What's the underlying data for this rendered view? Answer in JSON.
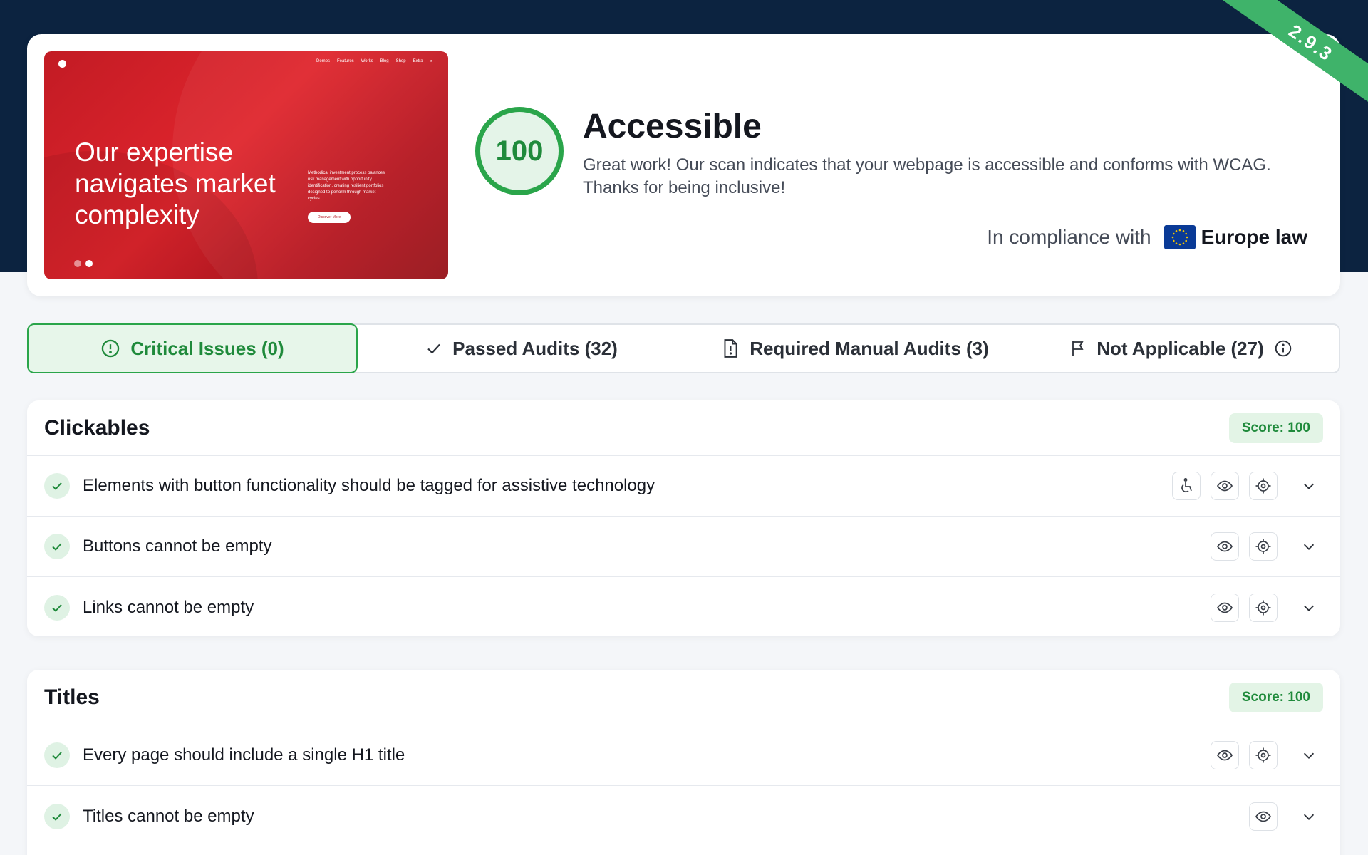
{
  "version": "2.9.3",
  "preview": {
    "nav": [
      "Demos",
      "Features",
      "Works",
      "Blog",
      "Shop",
      "Extra"
    ],
    "heading": "Our expertise navigates market complexity",
    "paragraph": "Methodical investment process balances risk management with opportunity identification, creating resilient portfolios designed to perform through market cycles.",
    "button": "Discover More"
  },
  "summary": {
    "score": "100",
    "title": "Accessible",
    "description": "Great work! Our scan indicates that your webpage is accessible and conforms with WCAG. Thanks for being inclusive!",
    "compliance_prefix": "In compliance with",
    "compliance_region": "Europe law"
  },
  "tabs": [
    {
      "label": "Critical Issues (0)",
      "icon": "alert-circle-icon",
      "active": true
    },
    {
      "label": "Passed Audits (32)",
      "icon": "check-icon"
    },
    {
      "label": "Required Manual Audits (3)",
      "icon": "document-icon"
    },
    {
      "label": "Not Applicable (27)",
      "icon": "flag-icon"
    }
  ],
  "sections": [
    {
      "title": "Clickables",
      "score": "Score: 100",
      "items": [
        {
          "label": "Elements with button functionality should be tagged for assistive technology",
          "actions": [
            "accessibility-icon",
            "eye-icon",
            "target-icon"
          ]
        },
        {
          "label": "Buttons cannot be empty",
          "actions": [
            "eye-icon",
            "target-icon"
          ]
        },
        {
          "label": "Links cannot be empty",
          "actions": [
            "eye-icon",
            "target-icon"
          ]
        }
      ]
    },
    {
      "title": "Titles",
      "score": "Score: 100",
      "items": [
        {
          "label": "Every page should include a single H1 title",
          "actions": [
            "eye-icon",
            "target-icon"
          ]
        },
        {
          "label": "Titles cannot be empty",
          "actions": [
            "eye-icon"
          ]
        }
      ]
    }
  ],
  "colors": {
    "header_bg": "#0c2340",
    "accent_green": "#2aa54a",
    "ribbon": "#3fb36a",
    "preview_red": "#d9232b"
  }
}
